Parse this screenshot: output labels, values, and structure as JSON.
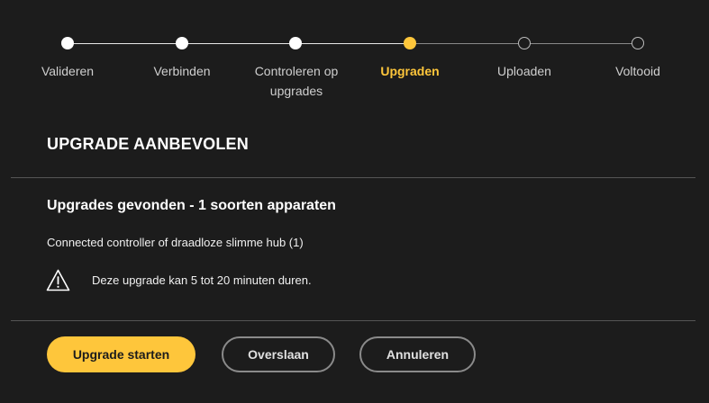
{
  "stepper": {
    "steps": [
      {
        "label": "Valideren",
        "state": "done"
      },
      {
        "label": "Verbinden",
        "state": "done"
      },
      {
        "label": "Controleren op upgrades",
        "state": "done"
      },
      {
        "label": "Upgraden",
        "state": "current"
      },
      {
        "label": "Uploaden",
        "state": "todo"
      },
      {
        "label": "Voltooid",
        "state": "todo"
      }
    ]
  },
  "panel": {
    "title": "UPGRADE AANBEVOLEN",
    "subtitle": "Upgrades gevonden - 1 soorten apparaten",
    "device": "Connected controller of draadloze slimme hub (1)",
    "warning_text": "Deze upgrade kan 5 tot 20 minuten duren.",
    "warning_icon": "warning-triangle-icon"
  },
  "actions": {
    "start_label": "Upgrade starten",
    "skip_label": "Overslaan",
    "cancel_label": "Annuleren"
  },
  "colors": {
    "background": "#1c1c1c",
    "accent": "#fec63b",
    "divider": "#555555"
  }
}
